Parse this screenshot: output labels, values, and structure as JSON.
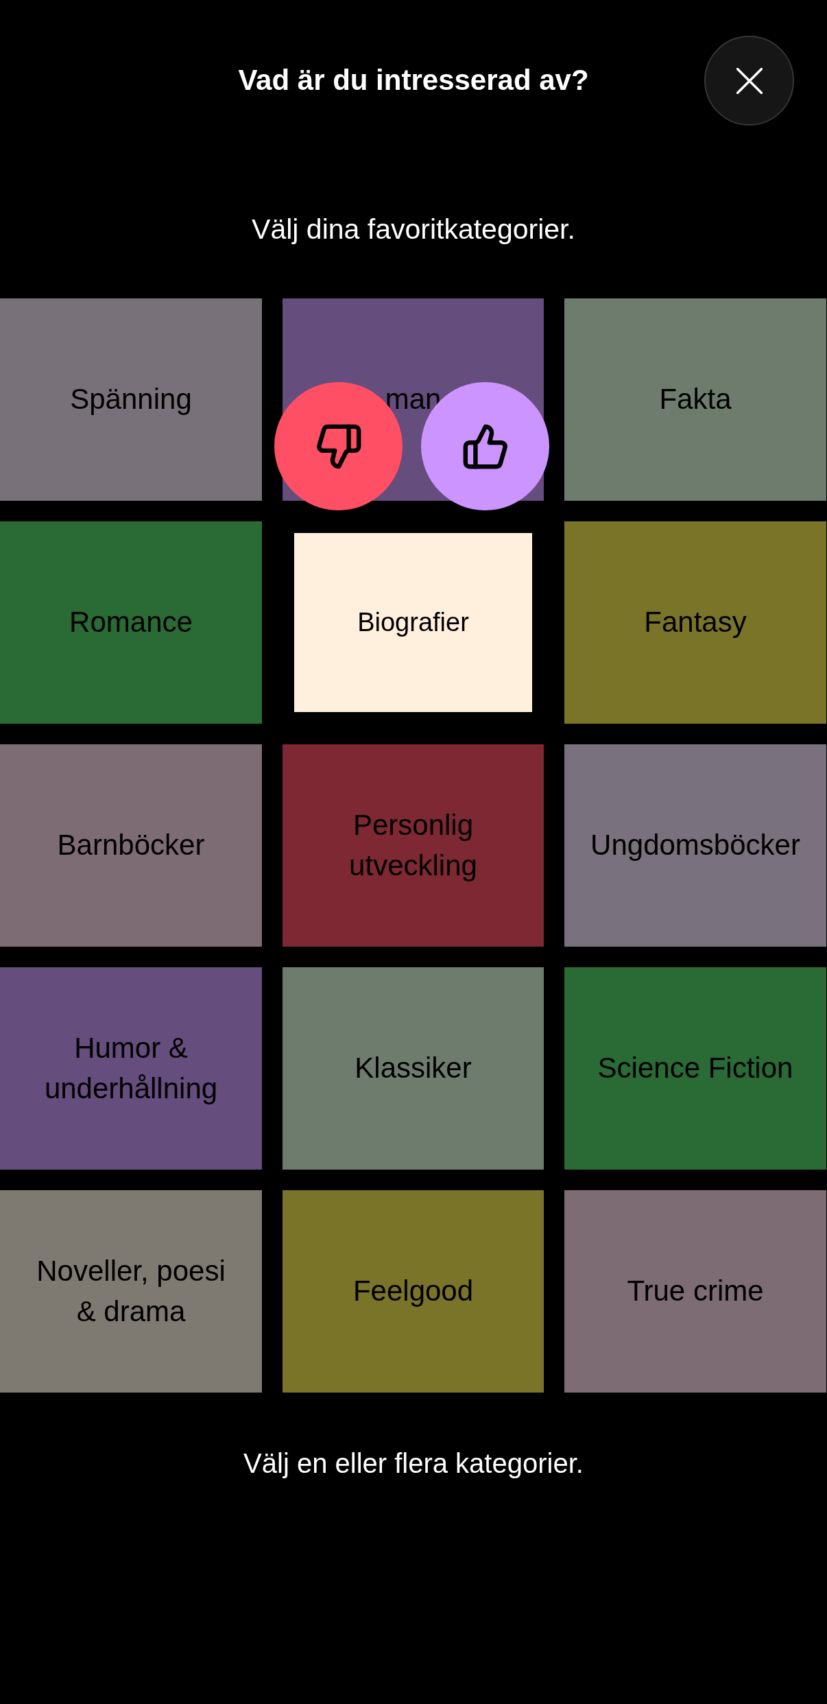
{
  "header": {
    "title": "Vad är du intresserad av?"
  },
  "subtitle": "Välj dina favoritkategorier.",
  "categories": [
    {
      "label": "Spänning",
      "color": "#797179",
      "selected": false
    },
    {
      "label": "man",
      "color": "#654d7d",
      "selected": false
    },
    {
      "label": "Fakta",
      "color": "#6e7c6d",
      "selected": false
    },
    {
      "label": "Romance",
      "color": "#296a35",
      "selected": false
    },
    {
      "label": "Biografier",
      "color": "#fff0de",
      "selected": true
    },
    {
      "label": "Fantasy",
      "color": "#7a7428",
      "selected": false
    },
    {
      "label": "Barnböcker",
      "color": "#7d6c73",
      "selected": false
    },
    {
      "label": "Personlig utveckling",
      "color": "#7d2833",
      "selected": false
    },
    {
      "label": "Ungdomsböcker",
      "color": "#79717e",
      "selected": false
    },
    {
      "label": "Humor & underhållning",
      "color": "#654d7d",
      "selected": false
    },
    {
      "label": "Klassiker",
      "color": "#6e7c6d",
      "selected": false
    },
    {
      "label": "Science Fiction",
      "color": "#296a35",
      "selected": false
    },
    {
      "label": "Noveller, poesi & drama",
      "color": "#7e7a72",
      "selected": false
    },
    {
      "label": "Feelgood",
      "color": "#7a7428",
      "selected": false
    },
    {
      "label": "True crime",
      "color": "#7d6c73",
      "selected": false
    }
  ],
  "rating_buttons": [
    {
      "kind": "dislike"
    },
    {
      "kind": "like"
    }
  ],
  "footer": {
    "hint": "Välj en eller flera kategorier."
  }
}
